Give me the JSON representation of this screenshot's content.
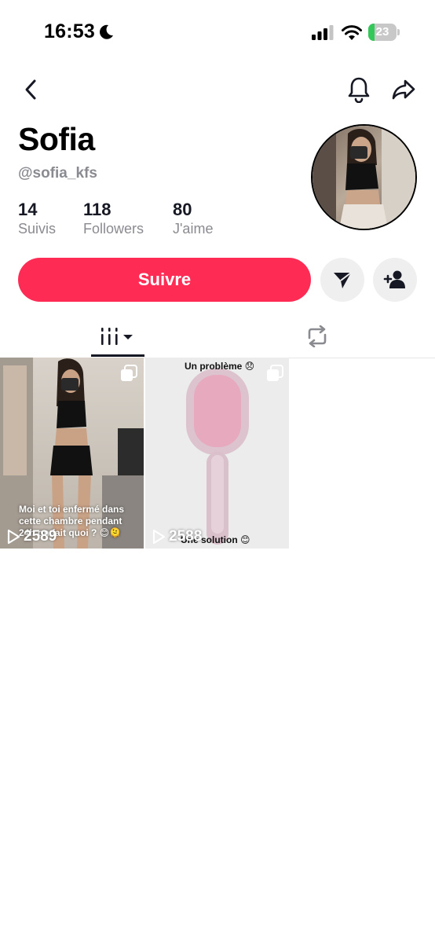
{
  "status_bar": {
    "time": "16:53",
    "battery_text": "23",
    "battery_level": 0.23,
    "battery_color": "#34c759"
  },
  "nav": {
    "back_icon": "chevron-left-icon",
    "bell_icon": "bell-icon",
    "share_icon": "share-arrow-icon"
  },
  "profile": {
    "name": "Sofia",
    "handle": "@sofia_kfs",
    "stats": [
      {
        "value": "14",
        "label": "Suivis"
      },
      {
        "value": "118",
        "label": "Followers"
      },
      {
        "value": "80",
        "label": "J'aime"
      }
    ]
  },
  "actions": {
    "follow_label": "Suivre",
    "follow_color": "#fe2c55",
    "message_icon": "send-icon",
    "add_friend_icon": "add-user-icon"
  },
  "tabs": [
    {
      "icon": "grid-menu-icon",
      "active": true
    },
    {
      "icon": "repost-icon",
      "active": false
    }
  ],
  "videos": [
    {
      "caption": "Moi et toi enfermé dans cette chambre pendant 24h on fait quoi ? 😊🫠",
      "views": "2589",
      "icon": "multi-photo-icon"
    },
    {
      "caption_top": "Un problème 😞",
      "caption_bottom": "Une solution 😊",
      "views": "2588",
      "icon": "multi-photo-icon"
    }
  ]
}
